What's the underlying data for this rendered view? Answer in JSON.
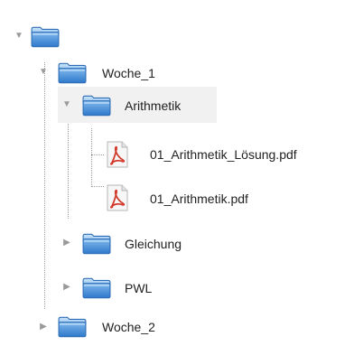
{
  "tree": {
    "root": {
      "icon": "folder-icon"
    },
    "woche1": {
      "label": "Woche_1",
      "icon": "folder-icon",
      "children": {
        "arithmetik": {
          "label": "Arithmetik",
          "icon": "folder-icon",
          "files": [
            {
              "label": "01_Arithmetik_Lösung.pdf",
              "icon": "pdf-file-icon"
            },
            {
              "label": "01_Arithmetik.pdf",
              "icon": "pdf-file-icon"
            }
          ]
        },
        "gleichung": {
          "label": "Gleichung",
          "icon": "folder-icon"
        },
        "pwl": {
          "label": "PWL",
          "icon": "folder-icon"
        }
      }
    },
    "woche2": {
      "label": "Woche_2",
      "icon": "folder-icon"
    }
  },
  "colors": {
    "folder_blue": "#3f88d6",
    "folder_light": "#9ccaf3",
    "pdf_red": "#d23a2b",
    "selected_row": "#f1f1f1",
    "connector": "#9a9a9a"
  }
}
